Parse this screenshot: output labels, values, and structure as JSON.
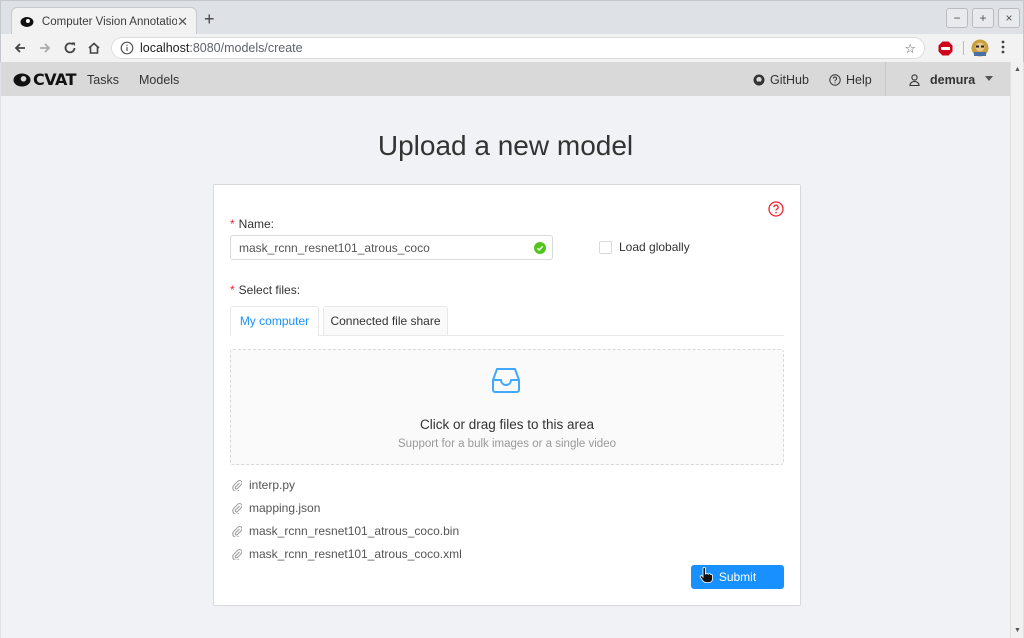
{
  "browser": {
    "tab_title": "Computer Vision Annotation To",
    "url_host": "localhost",
    "url_path": ":8080/models/create",
    "window_controls": [
      "−",
      "+",
      "×"
    ]
  },
  "header": {
    "logo_text": "CVAT",
    "menu": [
      "Tasks",
      "Models"
    ],
    "github_label": "GitHub",
    "help_label": "Help",
    "username": "demura"
  },
  "page": {
    "title": "Upload a new model"
  },
  "form": {
    "name_label": "Name:",
    "name_value": "mask_rcnn_resnet101_atrous_coco",
    "load_globally_label": "Load globally",
    "select_files_label": "Select files:",
    "tabs": [
      "My computer",
      "Connected file share"
    ],
    "active_tab": "My computer",
    "dropzone_text": "Click or drag files to this area",
    "dropzone_hint": "Support for a bulk images or a single video",
    "files": [
      "interp.py",
      "mapping.json",
      "mask_rcnn_resnet101_atrous_coco.bin",
      "mask_rcnn_resnet101_atrous_coco.xml"
    ],
    "submit_label": "Submit"
  },
  "colors": {
    "primary": "#1890ff",
    "required": "#f5222d",
    "success": "#52c41a",
    "help": "#f5222d"
  }
}
